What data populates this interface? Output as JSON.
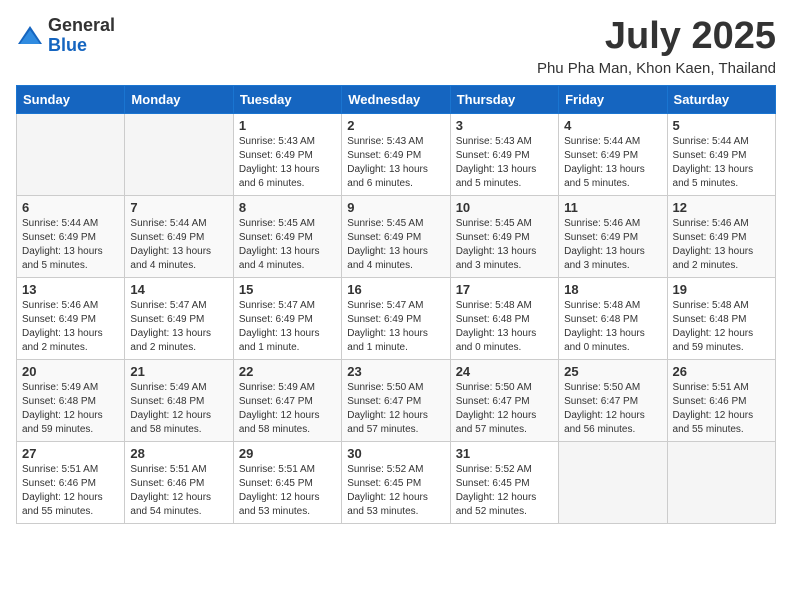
{
  "logo": {
    "general": "General",
    "blue": "Blue"
  },
  "title": {
    "month_year": "July 2025",
    "location": "Phu Pha Man, Khon Kaen, Thailand"
  },
  "headers": [
    "Sunday",
    "Monday",
    "Tuesday",
    "Wednesday",
    "Thursday",
    "Friday",
    "Saturday"
  ],
  "weeks": [
    [
      {
        "day": "",
        "sunrise": "",
        "sunset": "",
        "daylight": "",
        "empty": true
      },
      {
        "day": "",
        "sunrise": "",
        "sunset": "",
        "daylight": "",
        "empty": true
      },
      {
        "day": "1",
        "sunrise": "Sunrise: 5:43 AM",
        "sunset": "Sunset: 6:49 PM",
        "daylight": "Daylight: 13 hours and 6 minutes."
      },
      {
        "day": "2",
        "sunrise": "Sunrise: 5:43 AM",
        "sunset": "Sunset: 6:49 PM",
        "daylight": "Daylight: 13 hours and 6 minutes."
      },
      {
        "day": "3",
        "sunrise": "Sunrise: 5:43 AM",
        "sunset": "Sunset: 6:49 PM",
        "daylight": "Daylight: 13 hours and 5 minutes."
      },
      {
        "day": "4",
        "sunrise": "Sunrise: 5:44 AM",
        "sunset": "Sunset: 6:49 PM",
        "daylight": "Daylight: 13 hours and 5 minutes."
      },
      {
        "day": "5",
        "sunrise": "Sunrise: 5:44 AM",
        "sunset": "Sunset: 6:49 PM",
        "daylight": "Daylight: 13 hours and 5 minutes."
      }
    ],
    [
      {
        "day": "6",
        "sunrise": "Sunrise: 5:44 AM",
        "sunset": "Sunset: 6:49 PM",
        "daylight": "Daylight: 13 hours and 5 minutes."
      },
      {
        "day": "7",
        "sunrise": "Sunrise: 5:44 AM",
        "sunset": "Sunset: 6:49 PM",
        "daylight": "Daylight: 13 hours and 4 minutes."
      },
      {
        "day": "8",
        "sunrise": "Sunrise: 5:45 AM",
        "sunset": "Sunset: 6:49 PM",
        "daylight": "Daylight: 13 hours and 4 minutes."
      },
      {
        "day": "9",
        "sunrise": "Sunrise: 5:45 AM",
        "sunset": "Sunset: 6:49 PM",
        "daylight": "Daylight: 13 hours and 4 minutes."
      },
      {
        "day": "10",
        "sunrise": "Sunrise: 5:45 AM",
        "sunset": "Sunset: 6:49 PM",
        "daylight": "Daylight: 13 hours and 3 minutes."
      },
      {
        "day": "11",
        "sunrise": "Sunrise: 5:46 AM",
        "sunset": "Sunset: 6:49 PM",
        "daylight": "Daylight: 13 hours and 3 minutes."
      },
      {
        "day": "12",
        "sunrise": "Sunrise: 5:46 AM",
        "sunset": "Sunset: 6:49 PM",
        "daylight": "Daylight: 13 hours and 2 minutes."
      }
    ],
    [
      {
        "day": "13",
        "sunrise": "Sunrise: 5:46 AM",
        "sunset": "Sunset: 6:49 PM",
        "daylight": "Daylight: 13 hours and 2 minutes."
      },
      {
        "day": "14",
        "sunrise": "Sunrise: 5:47 AM",
        "sunset": "Sunset: 6:49 PM",
        "daylight": "Daylight: 13 hours and 2 minutes."
      },
      {
        "day": "15",
        "sunrise": "Sunrise: 5:47 AM",
        "sunset": "Sunset: 6:49 PM",
        "daylight": "Daylight: 13 hours and 1 minute."
      },
      {
        "day": "16",
        "sunrise": "Sunrise: 5:47 AM",
        "sunset": "Sunset: 6:49 PM",
        "daylight": "Daylight: 13 hours and 1 minute."
      },
      {
        "day": "17",
        "sunrise": "Sunrise: 5:48 AM",
        "sunset": "Sunset: 6:48 PM",
        "daylight": "Daylight: 13 hours and 0 minutes."
      },
      {
        "day": "18",
        "sunrise": "Sunrise: 5:48 AM",
        "sunset": "Sunset: 6:48 PM",
        "daylight": "Daylight: 13 hours and 0 minutes."
      },
      {
        "day": "19",
        "sunrise": "Sunrise: 5:48 AM",
        "sunset": "Sunset: 6:48 PM",
        "daylight": "Daylight: 12 hours and 59 minutes."
      }
    ],
    [
      {
        "day": "20",
        "sunrise": "Sunrise: 5:49 AM",
        "sunset": "Sunset: 6:48 PM",
        "daylight": "Daylight: 12 hours and 59 minutes."
      },
      {
        "day": "21",
        "sunrise": "Sunrise: 5:49 AM",
        "sunset": "Sunset: 6:48 PM",
        "daylight": "Daylight: 12 hours and 58 minutes."
      },
      {
        "day": "22",
        "sunrise": "Sunrise: 5:49 AM",
        "sunset": "Sunset: 6:47 PM",
        "daylight": "Daylight: 12 hours and 58 minutes."
      },
      {
        "day": "23",
        "sunrise": "Sunrise: 5:50 AM",
        "sunset": "Sunset: 6:47 PM",
        "daylight": "Daylight: 12 hours and 57 minutes."
      },
      {
        "day": "24",
        "sunrise": "Sunrise: 5:50 AM",
        "sunset": "Sunset: 6:47 PM",
        "daylight": "Daylight: 12 hours and 57 minutes."
      },
      {
        "day": "25",
        "sunrise": "Sunrise: 5:50 AM",
        "sunset": "Sunset: 6:47 PM",
        "daylight": "Daylight: 12 hours and 56 minutes."
      },
      {
        "day": "26",
        "sunrise": "Sunrise: 5:51 AM",
        "sunset": "Sunset: 6:46 PM",
        "daylight": "Daylight: 12 hours and 55 minutes."
      }
    ],
    [
      {
        "day": "27",
        "sunrise": "Sunrise: 5:51 AM",
        "sunset": "Sunset: 6:46 PM",
        "daylight": "Daylight: 12 hours and 55 minutes."
      },
      {
        "day": "28",
        "sunrise": "Sunrise: 5:51 AM",
        "sunset": "Sunset: 6:46 PM",
        "daylight": "Daylight: 12 hours and 54 minutes."
      },
      {
        "day": "29",
        "sunrise": "Sunrise: 5:51 AM",
        "sunset": "Sunset: 6:45 PM",
        "daylight": "Daylight: 12 hours and 53 minutes."
      },
      {
        "day": "30",
        "sunrise": "Sunrise: 5:52 AM",
        "sunset": "Sunset: 6:45 PM",
        "daylight": "Daylight: 12 hours and 53 minutes."
      },
      {
        "day": "31",
        "sunrise": "Sunrise: 5:52 AM",
        "sunset": "Sunset: 6:45 PM",
        "daylight": "Daylight: 12 hours and 52 minutes."
      },
      {
        "day": "",
        "sunrise": "",
        "sunset": "",
        "daylight": "",
        "empty": true
      },
      {
        "day": "",
        "sunrise": "",
        "sunset": "",
        "daylight": "",
        "empty": true
      }
    ]
  ]
}
